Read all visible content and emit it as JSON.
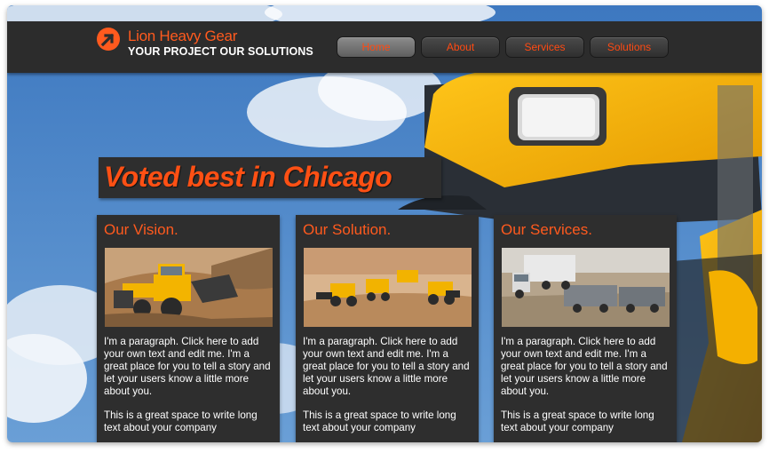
{
  "header": {
    "brand_name": "Lion Heavy Gear",
    "tagline": "YOUR PROJECT OUR SOLUTIONS"
  },
  "nav": {
    "items": [
      {
        "label": "Home",
        "active": true
      },
      {
        "label": "About",
        "active": false
      },
      {
        "label": "Services",
        "active": false
      },
      {
        "label": "Solutions",
        "active": false
      }
    ]
  },
  "hero": {
    "headline": "Voted best in Chicago"
  },
  "cards": [
    {
      "title": "Our Vision.",
      "image": "bulldozer-photo",
      "paragraph": "I'm a paragraph. Click here to add your own text and edit me. I'm a great place for you to tell a story and let your users know a little more about you.",
      "paragraph2": "This is a great space to write long text about your company"
    },
    {
      "title": "Our Solution.",
      "image": "construction-fleet-photo",
      "paragraph": "I'm a paragraph. Click here to add your own text and edit me. I'm a great place for you to tell a story and let your users know a little more about you.",
      "paragraph2": "This is a great space to write long text about your company"
    },
    {
      "title": "Our Services.",
      "image": "dump-trucks-photo",
      "paragraph": "I'm a paragraph. Click here to add your own text and edit me. I'm a great place for you to tell a story and let your users know a little more about you.",
      "paragraph2": "This is a great space to write long text about your company"
    }
  ],
  "colors": {
    "accent": "#ff5a1e",
    "panel": "#2e2e2e",
    "sky": "#4f86c6",
    "machine_yellow": "#f5b400"
  }
}
